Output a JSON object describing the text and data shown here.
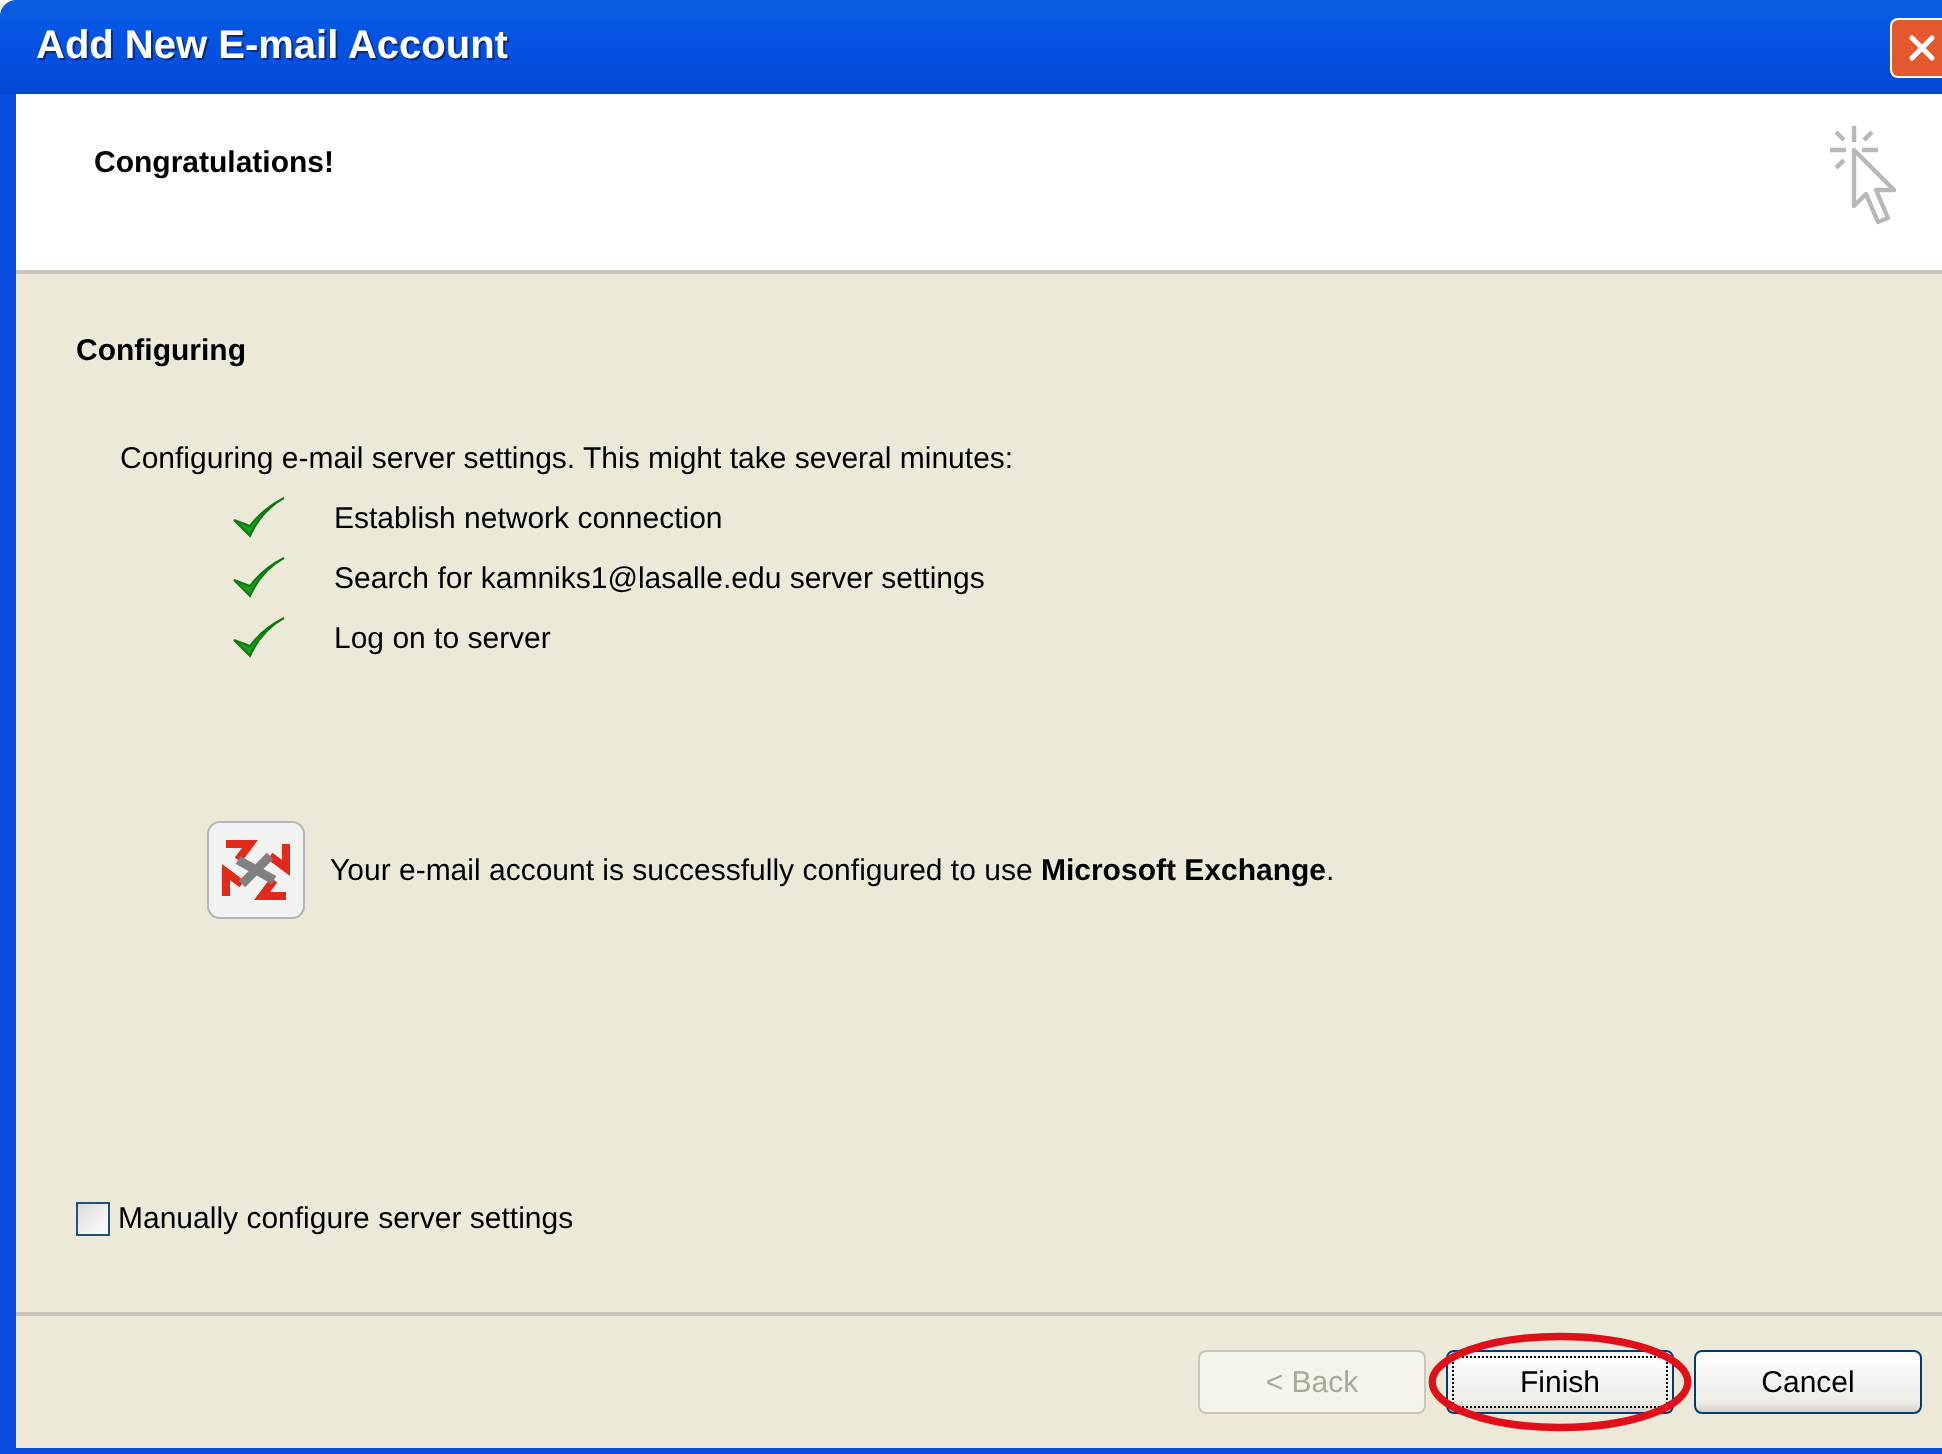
{
  "window": {
    "title": "Add New E-mail Account"
  },
  "header": {
    "title": "Congratulations!"
  },
  "section": {
    "title": "Configuring"
  },
  "intro": "Configuring e-mail server settings. This might take several minutes:",
  "steps": [
    {
      "label": "Establish network connection",
      "done": true
    },
    {
      "label": "Search for kamniks1@lasalle.edu server settings",
      "done": true
    },
    {
      "label": "Log on to server",
      "done": true
    }
  ],
  "result": "Your e-mail account is successfully configured to use **Microsoft Exchange**.",
  "manual_config": {
    "label": "Manually configure server settings",
    "checked": false
  },
  "buttons": [
    {
      "label": "< Back",
      "disabled": true,
      "focused": false,
      "highlighted": false
    },
    {
      "label": "Finish",
      "disabled": false,
      "focused": true,
      "highlighted": true
    },
    {
      "label": "Cancel",
      "disabled": false,
      "focused": false,
      "highlighted": false
    }
  ]
}
